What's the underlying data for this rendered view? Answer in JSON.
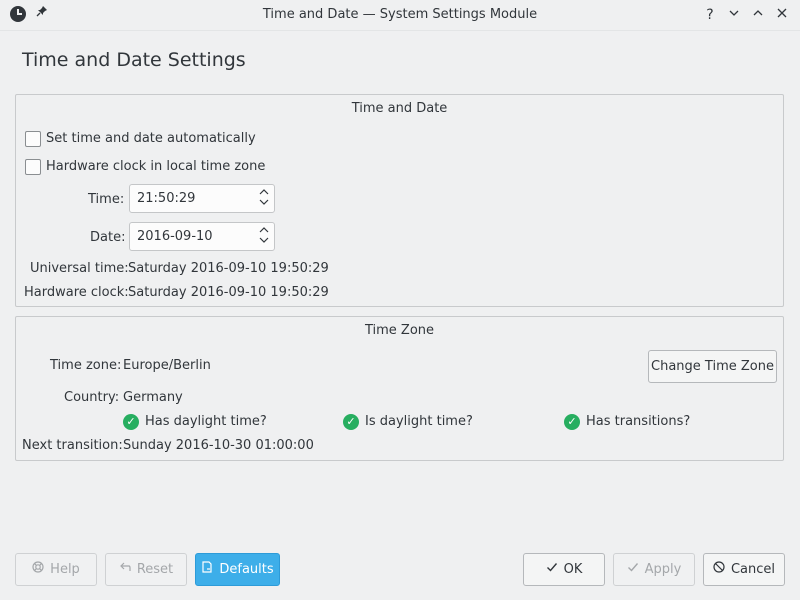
{
  "window": {
    "title": "Time and Date — System Settings Module",
    "app_icon": "clock-icon",
    "pin_icon": "pin-icon",
    "buttons": {
      "help": "?",
      "minimize": "⌄",
      "maximize": "⌃",
      "close": "✕"
    }
  },
  "page_title": "Time and Date Settings",
  "time_date_group": {
    "title": "Time and Date",
    "auto_checkbox": {
      "label": "Set time and date automatically",
      "checked": false
    },
    "hwclock_checkbox": {
      "label": "Hardware clock in local time zone",
      "checked": false
    },
    "time": {
      "label": "Time:",
      "value": "21:50:29"
    },
    "date": {
      "label": "Date:",
      "value": "2016-09-10"
    },
    "universal": {
      "label": "Universal time:",
      "value": "Saturday 2016-09-10 19:50:29"
    },
    "hardware": {
      "label": "Hardware clock:",
      "value": "Saturday 2016-09-10 19:50:29"
    }
  },
  "time_zone_group": {
    "title": "Time Zone",
    "zone": {
      "label": "Time zone:",
      "value": "Europe/Berlin"
    },
    "change_button": "Change Time Zone",
    "country": {
      "label": "Country:",
      "value": "Germany"
    },
    "flags": [
      {
        "label": "Has daylight time?",
        "icon": "check-icon"
      },
      {
        "label": "Is daylight time?",
        "icon": "check-icon"
      },
      {
        "label": "Has transitions?",
        "icon": "check-icon"
      }
    ],
    "next_transition": {
      "label": "Next transition:",
      "value": "Sunday 2016-10-30 01:00:00"
    }
  },
  "footer": {
    "help": {
      "label": "Help",
      "icon": "lifebuoy-icon",
      "enabled": false
    },
    "reset": {
      "label": "Reset",
      "icon": "undo-icon",
      "enabled": false
    },
    "defaults": {
      "label": "Defaults",
      "icon": "document-icon",
      "enabled": true
    },
    "ok": {
      "label": "OK",
      "icon": "checkmark-icon",
      "enabled": true
    },
    "apply": {
      "label": "Apply",
      "icon": "checkmark-icon",
      "enabled": false
    },
    "cancel": {
      "label": "Cancel",
      "icon": "cancel-icon",
      "enabled": true
    }
  },
  "colors": {
    "accent": "#3daee9",
    "check_green": "#27ae60",
    "background": "#eff0f1"
  }
}
